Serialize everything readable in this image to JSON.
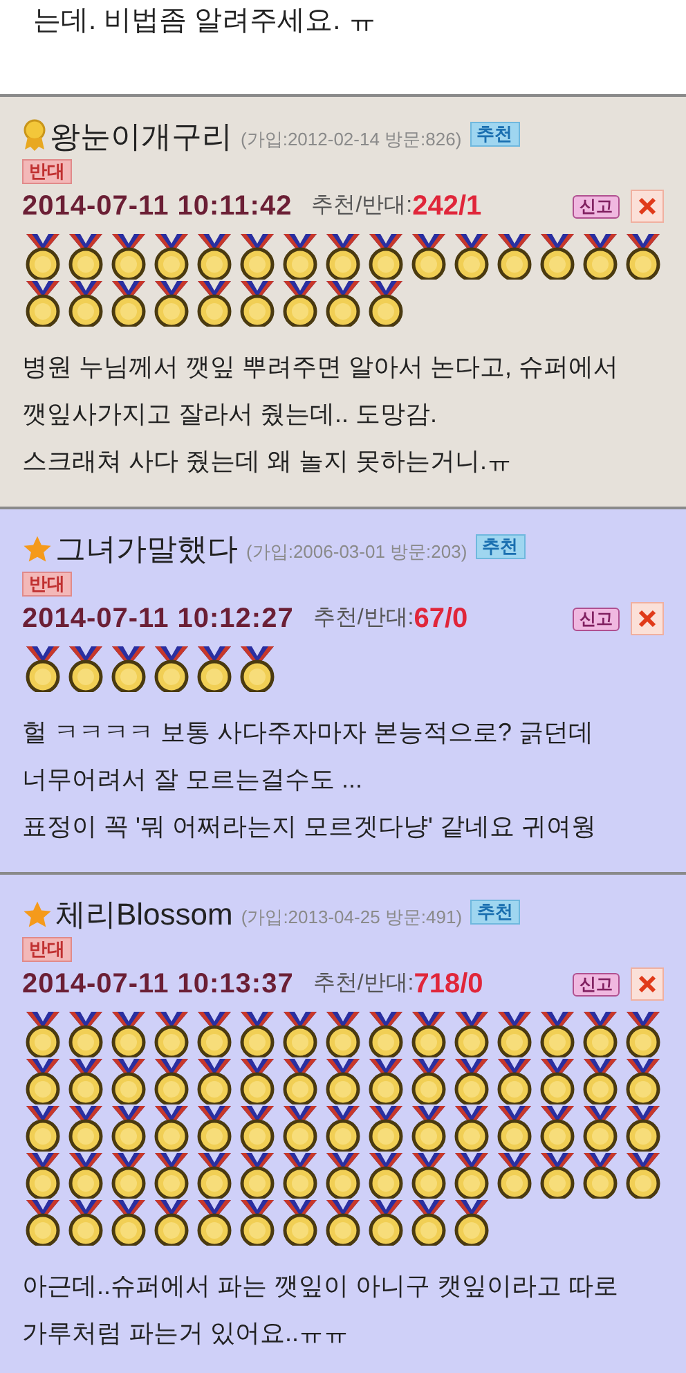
{
  "post_tail": "는데. 비법좀 알려주세요. ㅠ",
  "comments": [
    {
      "kind": "medal",
      "color": "#e6e1da",
      "name": "왕눈이개구리",
      "meta": "(가입:2012-02-14 방문:826)",
      "up_label": "추천",
      "down_label": "반대",
      "date": "2014-07-11 10:11:42",
      "score_label": "추천/반대:",
      "score": "242/1",
      "report_label": "신고",
      "medal_rows": [
        [
          {
            "stars": 10
          },
          {
            "stars": 5
          }
        ],
        [
          {
            "stars": 9
          }
        ]
      ],
      "lines": [
        "병원 누님께서 깻잎 뿌려주면 알아서 논다고, 슈퍼에서",
        "깻잎사가지고 잘라서 줬는데.. 도망감.",
        "스크래쳐 사다 줬는데 왜 놀지 못하는거니.ㅠ"
      ]
    },
    {
      "kind": "star",
      "color": "#cfd0f8",
      "name": "그녀가말했다",
      "meta": "(가입:2006-03-01 방문:203)",
      "up_label": "추천",
      "down_label": "반대",
      "date": "2014-07-11 10:12:27",
      "score_label": "추천/반대:",
      "score": "67/0",
      "report_label": "신고",
      "medal_rows": [
        [
          {
            "stars": 6
          }
        ]
      ],
      "lines": [
        "헐 ㅋㅋㅋㅋ 보통 사다주자마자 본능적으로? 긁던데",
        "너무어려서 잘 모르는걸수도 ...",
        "표정이 꼭 '뭐 어쩌라는지 모르겟다냥' 같네요 귀여웡"
      ]
    },
    {
      "kind": "star",
      "color": "#cfd0f8",
      "name": "체리Blossom",
      "meta": "(가입:2013-04-25 방문:491)",
      "up_label": "추천",
      "down_label": "반대",
      "date": "2014-07-11 10:13:37",
      "score_label": "추천/반대:",
      "score": "718/0",
      "report_label": "신고",
      "medal_rows": [
        [
          {
            "stars": 10
          },
          {
            "stars": 5
          }
        ],
        [
          {
            "stars": 10
          },
          {
            "stars": 5
          }
        ],
        [
          {
            "stars": 10
          },
          {
            "stars": 5
          }
        ],
        [
          {
            "stars": 10
          },
          {
            "stars": 5
          }
        ],
        [
          {
            "stars": 6
          },
          {
            "stars": 5
          }
        ]
      ],
      "lines": [
        "아근데..슈퍼에서 파는 깻잎이 아니구 캣잎이라고 따로",
        "가루처럼 파는거 있어요..ㅠㅠ"
      ]
    }
  ]
}
